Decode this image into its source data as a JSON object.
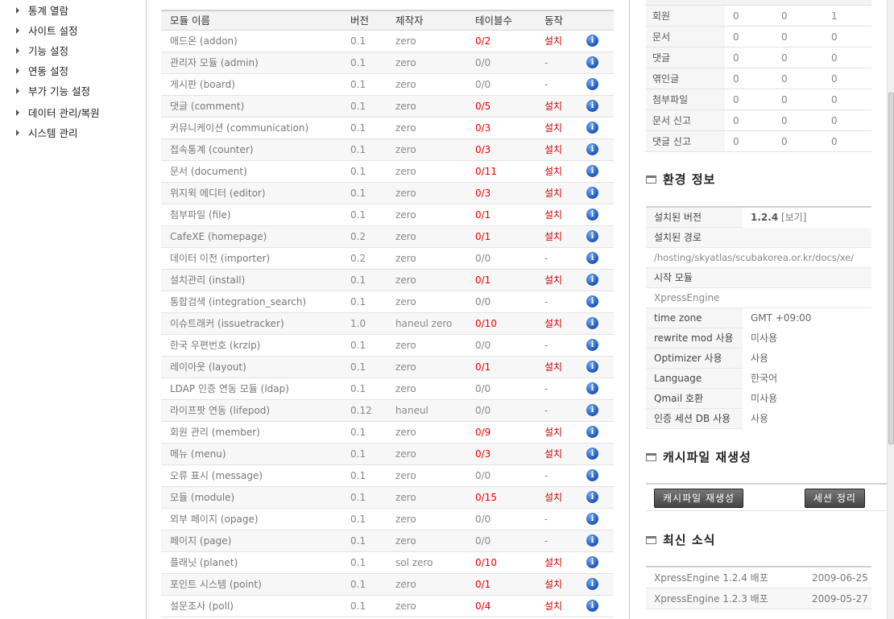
{
  "sidebar": {
    "items": [
      {
        "label": "통계 열람"
      },
      {
        "label": "사이트 설정"
      },
      {
        "label": "기능 설정"
      },
      {
        "label": "연동 설정"
      },
      {
        "label": "부가 기능 설정"
      },
      {
        "label": "데이터 관리/복원"
      },
      {
        "label": "시스템 관리"
      }
    ]
  },
  "modules": {
    "headers": {
      "name": "모듈 이름",
      "version": "버전",
      "maker": "제작자",
      "tables": "테이블수",
      "action": "동작"
    },
    "rows": [
      {
        "name": "애드온 (addon)",
        "version": "0.1",
        "maker": "zero",
        "tables": "0/2",
        "action": "설치"
      },
      {
        "name": "관리자 모듈 (admin)",
        "version": "0.1",
        "maker": "zero",
        "tables": "0/0",
        "action": "-"
      },
      {
        "name": "게시판 (board)",
        "version": "0.1",
        "maker": "zero",
        "tables": "0/0",
        "action": "-"
      },
      {
        "name": "댓글 (comment)",
        "version": "0.1",
        "maker": "zero",
        "tables": "0/5",
        "action": "설치"
      },
      {
        "name": "커뮤니케이션 (communication)",
        "version": "0.1",
        "maker": "zero",
        "tables": "0/3",
        "action": "설치"
      },
      {
        "name": "접속통계 (counter)",
        "version": "0.1",
        "maker": "zero",
        "tables": "0/3",
        "action": "설치"
      },
      {
        "name": "문서 (document)",
        "version": "0.1",
        "maker": "zero",
        "tables": "0/11",
        "action": "설치"
      },
      {
        "name": "위지윅 에디터 (editor)",
        "version": "0.1",
        "maker": "zero",
        "tables": "0/3",
        "action": "설치"
      },
      {
        "name": "첨부파일 (file)",
        "version": "0.1",
        "maker": "zero",
        "tables": "0/1",
        "action": "설치"
      },
      {
        "name": "CafeXE (homepage)",
        "version": "0.2",
        "maker": "zero",
        "tables": "0/1",
        "action": "설치"
      },
      {
        "name": "데이터 이전 (importer)",
        "version": "0.2",
        "maker": "zero",
        "tables": "0/0",
        "action": "-"
      },
      {
        "name": "설치관리 (install)",
        "version": "0.1",
        "maker": "zero",
        "tables": "0/1",
        "action": "설치"
      },
      {
        "name": "통합검색 (integration_search)",
        "version": "0.1",
        "maker": "zero",
        "tables": "0/0",
        "action": "-"
      },
      {
        "name": "이슈트래커 (issuetracker)",
        "version": "1.0",
        "maker": "haneul zero",
        "tables": "0/10",
        "action": "설치"
      },
      {
        "name": "한국 우편번호 (krzip)",
        "version": "0.1",
        "maker": "zero",
        "tables": "0/0",
        "action": "-"
      },
      {
        "name": "레이아웃 (layout)",
        "version": "0.1",
        "maker": "zero",
        "tables": "0/1",
        "action": "설치"
      },
      {
        "name": "LDAP 인증 연동 모듈 (ldap)",
        "version": "0.1",
        "maker": "zero",
        "tables": "0/0",
        "action": "-"
      },
      {
        "name": "라이프팟 연동 (lifepod)",
        "version": "0.12",
        "maker": "haneul",
        "tables": "0/0",
        "action": "-"
      },
      {
        "name": "회원 관리 (member)",
        "version": "0.1",
        "maker": "zero",
        "tables": "0/9",
        "action": "설치"
      },
      {
        "name": "메뉴 (menu)",
        "version": "0.1",
        "maker": "zero",
        "tables": "0/3",
        "action": "설치"
      },
      {
        "name": "오류 표시 (message)",
        "version": "0.1",
        "maker": "zero",
        "tables": "0/0",
        "action": "-"
      },
      {
        "name": "모듈 (module)",
        "version": "0.1",
        "maker": "zero",
        "tables": "0/15",
        "action": "설치"
      },
      {
        "name": "외부 페이지 (opage)",
        "version": "0.1",
        "maker": "zero",
        "tables": "0/0",
        "action": "-"
      },
      {
        "name": "페이지 (page)",
        "version": "0.1",
        "maker": "zero",
        "tables": "0/0",
        "action": "-"
      },
      {
        "name": "플래닛 (planet)",
        "version": "0.1",
        "maker": "sol zero",
        "tables": "0/10",
        "action": "설치"
      },
      {
        "name": "포인트 시스템 (point)",
        "version": "0.1",
        "maker": "zero",
        "tables": "0/1",
        "action": "설치"
      },
      {
        "name": "설문조사 (poll)",
        "version": "0.1",
        "maker": "zero",
        "tables": "0/4",
        "action": "설치"
      }
    ]
  },
  "stats": {
    "rows": [
      {
        "label": "회원",
        "v1": "0",
        "v2": "0",
        "v3": "1"
      },
      {
        "label": "문서",
        "v1": "0",
        "v2": "0",
        "v3": "0"
      },
      {
        "label": "댓글",
        "v1": "0",
        "v2": "0",
        "v3": "0"
      },
      {
        "label": "엮인글",
        "v1": "0",
        "v2": "0",
        "v3": "0"
      },
      {
        "label": "첨부파일",
        "v1": "0",
        "v2": "0",
        "v3": "0"
      },
      {
        "label": "문서 신고",
        "v1": "0",
        "v2": "0",
        "v3": "0"
      },
      {
        "label": "댓글 신고",
        "v1": "0",
        "v2": "0",
        "v3": "0"
      }
    ]
  },
  "env": {
    "title": "환경 정보",
    "installed_version_label": "설치된 버전",
    "installed_version": "1.2.4",
    "view_link": "[보기]",
    "install_path_label": "설치된 경로",
    "install_path": "/hosting/skyatlas/scubakorea.or.kr/docs/xe/",
    "start_module_label": "시작 모듈",
    "start_module": "XpressEngine",
    "pairs": [
      {
        "key": "time zone",
        "value": "GMT +09:00"
      },
      {
        "key": "rewrite mod 사용",
        "value": "미사용"
      },
      {
        "key": "Optimizer 사용",
        "value": "사용"
      },
      {
        "key": "Language",
        "value": "한국어"
      },
      {
        "key": "Qmail 호환",
        "value": "미사용"
      },
      {
        "key": "인증 세션 DB 사용",
        "value": "사용"
      }
    ]
  },
  "cache": {
    "title": "캐시파일 재생성",
    "regen_button": "캐시파일 재생성",
    "session_button": "세션 정리"
  },
  "news": {
    "title": "최신 소식",
    "items": [
      {
        "title": "XpressEngine 1.2.4 배포",
        "date": "2009-06-25"
      },
      {
        "title": "XpressEngine 1.2.3 배포",
        "date": "2009-05-27"
      }
    ]
  }
}
